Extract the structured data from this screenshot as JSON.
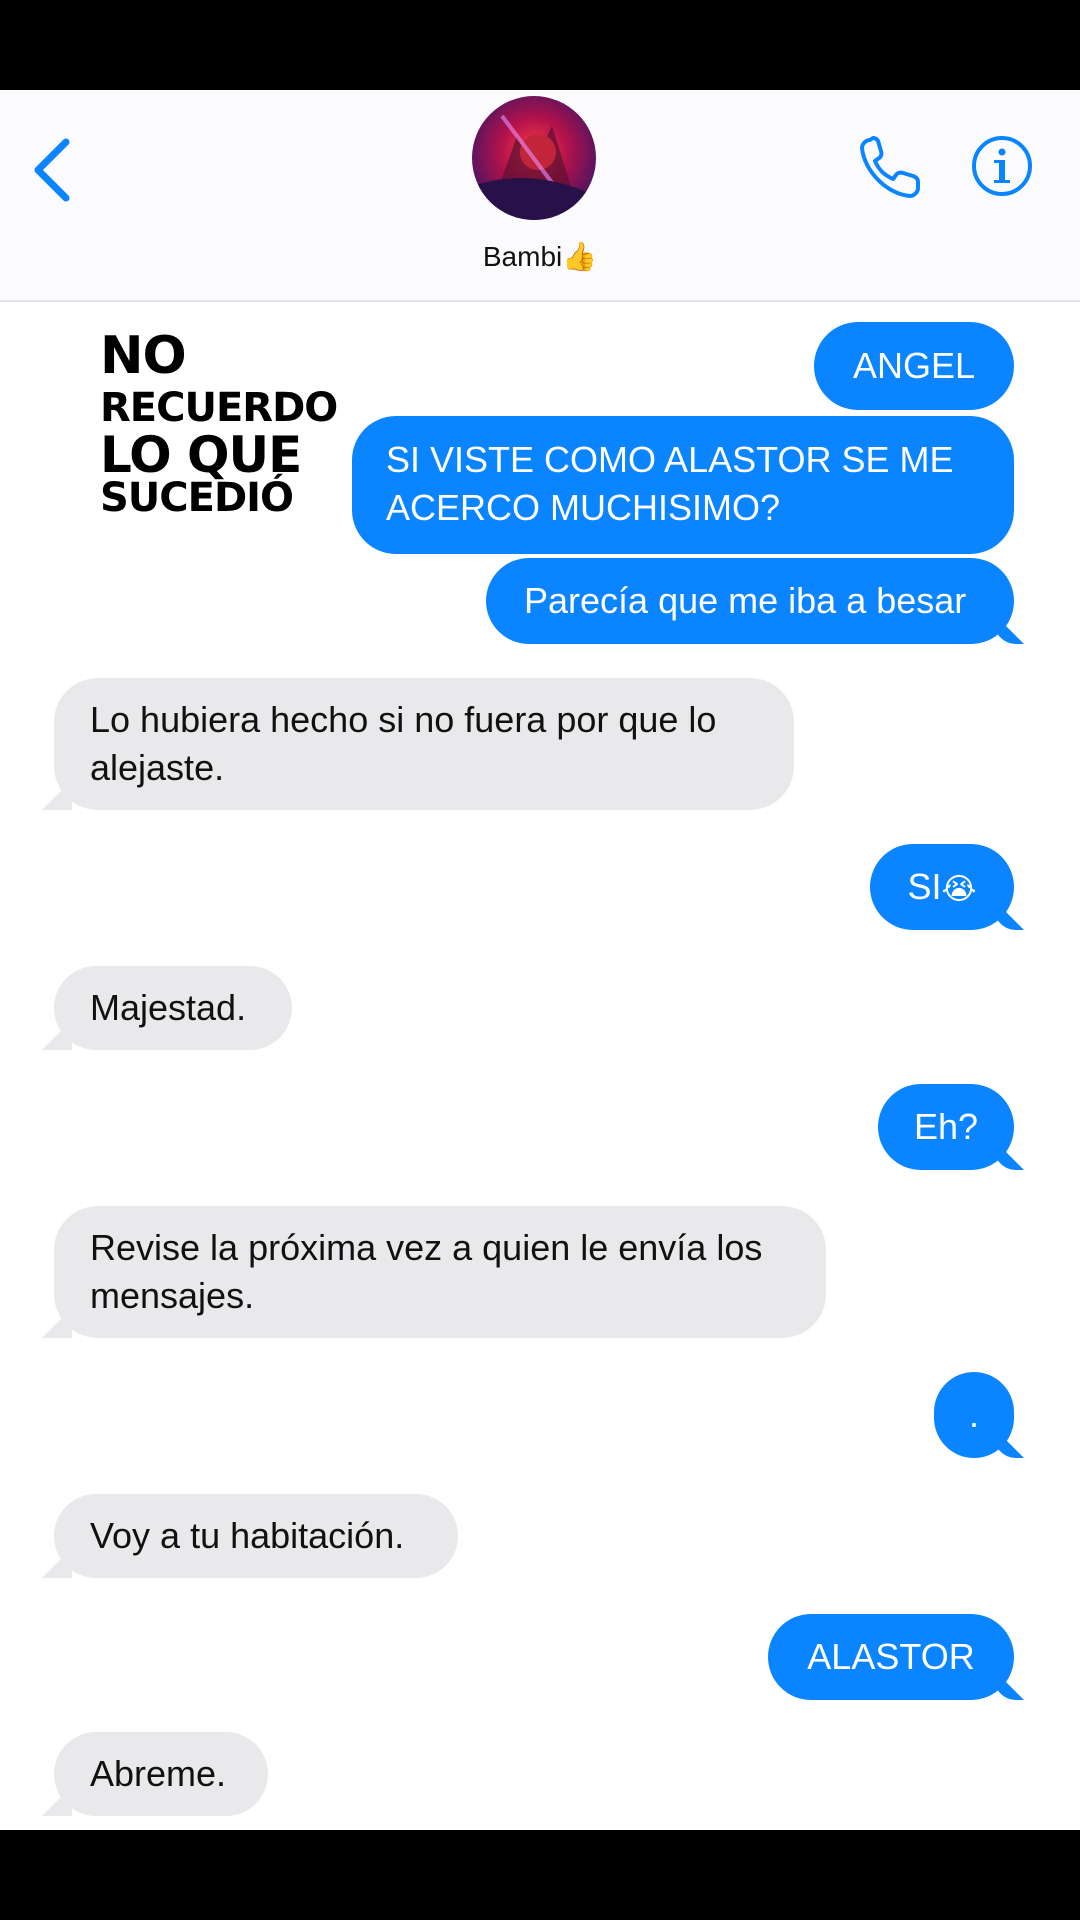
{
  "header": {
    "contact_name": "Bambi",
    "contact_emoji": "👍",
    "back_icon": "chevron-left-icon",
    "call_icon": "phone-icon",
    "info_icon": "info-icon",
    "accent_color": "#0a84ff"
  },
  "overlay_caption": {
    "line1": "NO",
    "line2": "RECUERDO",
    "line3": "LO QUE",
    "line4": "SUCEDIÓ"
  },
  "messages": [
    {
      "from": "me",
      "text": "ANGEL"
    },
    {
      "from": "me",
      "line1": "SI VISTE COMO ALASTOR SE ME",
      "line2": "ACERCO MUCHISIMO?"
    },
    {
      "from": "me",
      "text": "Parecía que me iba a besar"
    },
    {
      "from": "them",
      "line1": "Lo hubiera hecho si no fuera por que lo",
      "line2": "alejaste."
    },
    {
      "from": "me",
      "text": "SI",
      "emoji": "😭"
    },
    {
      "from": "them",
      "text": "Majestad."
    },
    {
      "from": "me",
      "text": "Eh?"
    },
    {
      "from": "them",
      "line1": "Revise la próxima vez a quien le envía los",
      "line2": "mensajes."
    },
    {
      "from": "me",
      "text": "."
    },
    {
      "from": "them",
      "text": "Voy a tu habitación."
    },
    {
      "from": "me",
      "text": "ALASTOR"
    },
    {
      "from": "them",
      "text": "Abreme."
    }
  ]
}
